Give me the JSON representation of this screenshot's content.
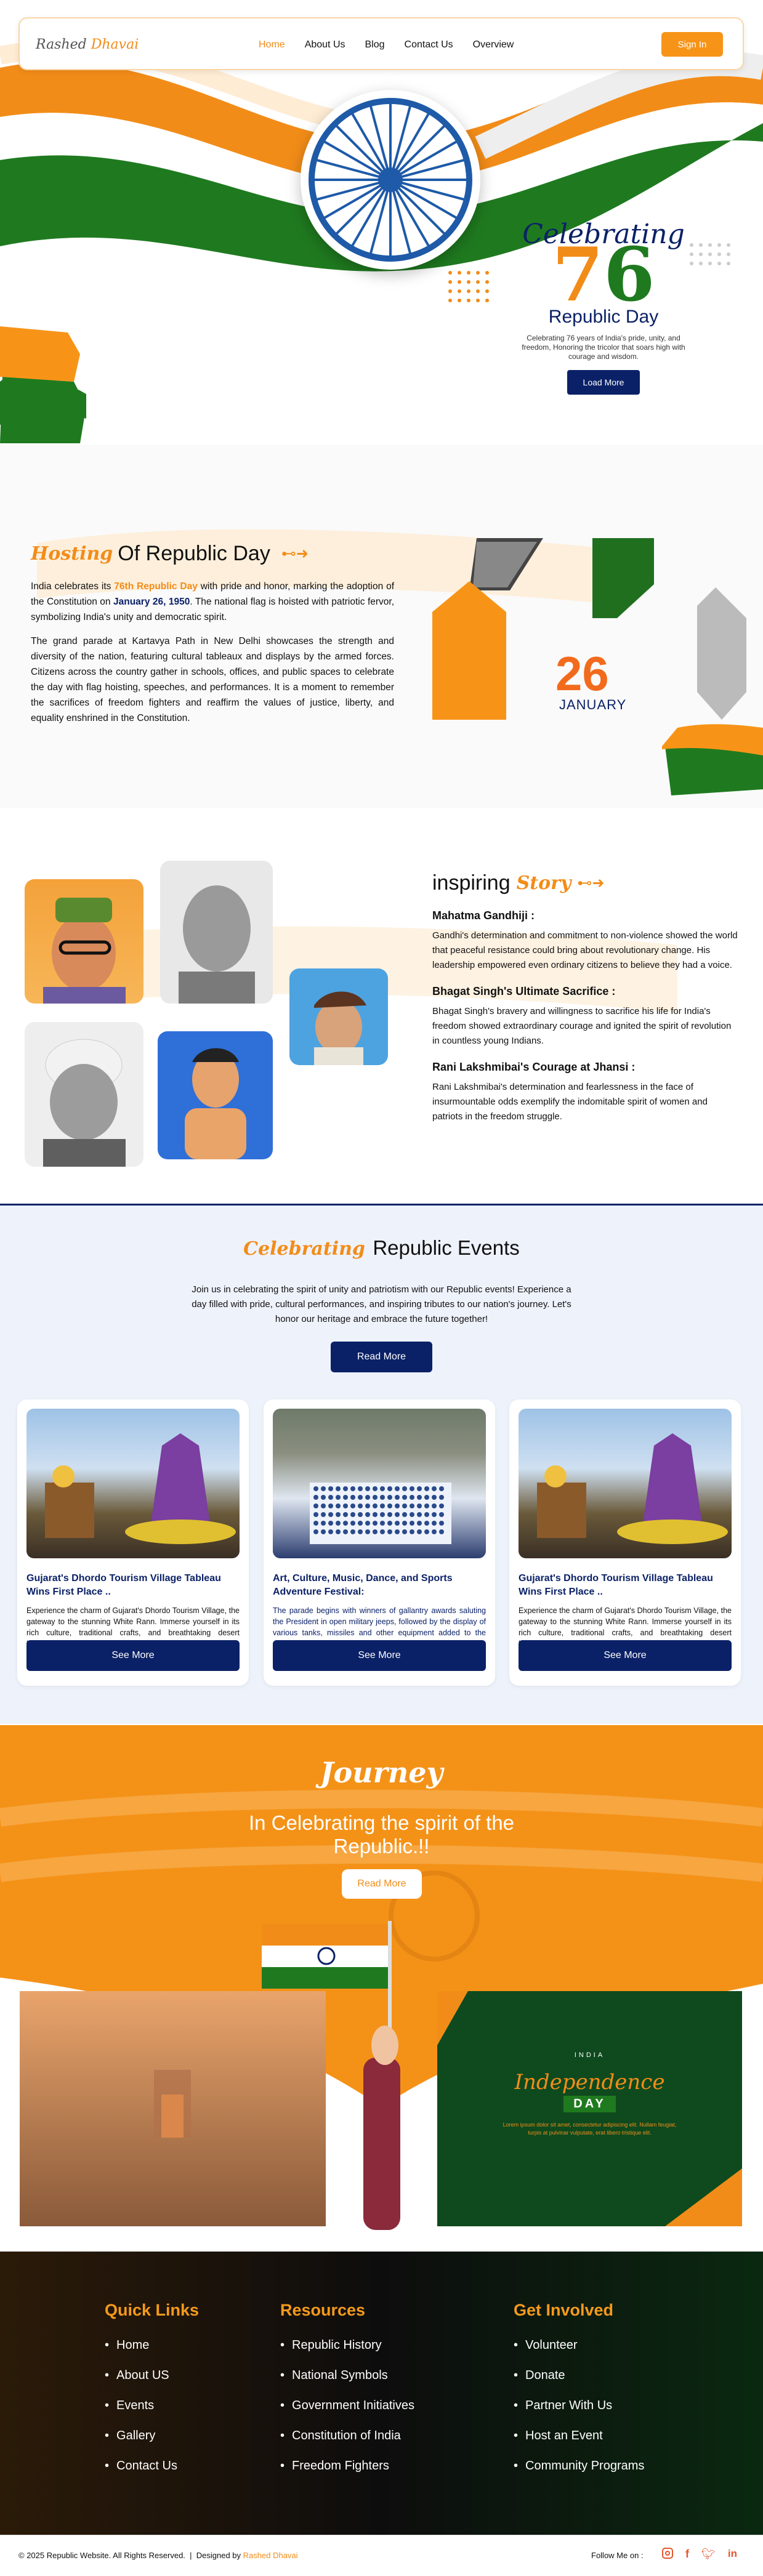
{
  "nav": {
    "logo_main": "Rashed",
    "logo_accent": "Dhavai",
    "links": [
      "Home",
      "About Us",
      "Blog",
      "Contact Us",
      "Overview"
    ],
    "signin": "Sign In"
  },
  "hero": {
    "celebrating": "Celebrating",
    "number": [
      "7",
      "6"
    ],
    "title": "Republic Day",
    "subtitle": "Celebrating 76 years of India's pride, unity, and freedom, Honoring the tricolor that soars high with courage and wisdom.",
    "button": "Load More"
  },
  "hosting": {
    "title_script": "Hosting",
    "title_rest": "Of Republic Day",
    "p1_a": "India celebrates its ",
    "p1_b": "76th Republic Day",
    "p1_c": " with pride and honor, marking the adoption of the Constitution on ",
    "p1_d": "January 26, 1950",
    "p1_e": ". The national flag is hoisted with patriotic fervor, symbolizing India's unity and democratic spirit.",
    "p2": "The grand parade at Kartavya Path in New Delhi showcases the strength and diversity of the nation, featuring cultural tableaux and displays by the armed forces. Citizens across the country gather in schools, offices, and public spaces to celebrate the day with flag hoisting, speeches, and performances. It is a moment to remember the sacrifices of freedom fighters and reaffirm the values of justice, liberty, and equality enshrined in the Constitution.",
    "date_num": "26",
    "date_month": "JANUARY"
  },
  "inspiring": {
    "title_a": "inspiring",
    "title_b": "Story",
    "people": [
      {
        "name": "Mahatma Gandhiji :",
        "text": "Gandhi's determination and commitment to non-violence showed the world that peaceful resistance could bring about revolutionary change. His leadership empowered even ordinary citizens to believe they had a voice."
      },
      {
        "name": "Bhagat Singh's Ultimate Sacrifice :",
        "text": "Bhagat Singh's bravery and willingness to sacrifice his life for India's freedom showed extraordinary courage and ignited the spirit of revolution in countless young Indians."
      },
      {
        "name": "Rani Lakshmibai's Courage at Jhansi :",
        "text": "Rani Lakshmibai's determination and fearlessness in the face of insurmountable odds exemplify the indomitable spirit of women and patriots in the freedom struggle."
      }
    ]
  },
  "events": {
    "title_a": "Celebrating",
    "title_b": "Republic Events",
    "intro": "Join us in celebrating the spirit of unity and patriotism with our Republic events! Experience a day filled with pride, cultural performances, and inspiring tributes to our nation's journey. Let's honor our heritage and embrace the future together!",
    "button": "Read More",
    "cards": [
      {
        "title": "Gujarat's Dhordo Tourism Village Tableau Wins First Place ..",
        "desc": "Experience the charm of Gujarat's Dhordo Tourism Village, the gateway to the stunning White Rann. Immerse yourself in its rich culture, traditional crafts, and breathtaking desert landscapes!",
        "button": "See More"
      },
      {
        "title": "Art, Culture, Music, Dance, and Sports Adventure Festival:",
        "desc": "The parade begins with winners of gallantry awards saluting the President in open military jeeps, followed by the display of various tanks, missiles and other equipment added to the arsenal of the military.",
        "button": "See More"
      },
      {
        "title": "Gujarat's Dhordo Tourism Village Tableau Wins First Place ..",
        "desc": "Experience the charm of Gujarat's Dhordo Tourism Village, the gateway to the stunning White Rann. Immerse yourself in its rich culture, traditional crafts, and breathtaking desert landscapes!",
        "button": "See More"
      }
    ]
  },
  "journey": {
    "script": "Journey",
    "headline": "In Celebrating the spirit of the Republic.!!",
    "button": "Read More",
    "poster_india": "INDIA",
    "poster_title": "Independence",
    "poster_day": "DAY",
    "poster_text": "Lorem ipsum dolor sit amet, consectetur adipiscing elit. Nullam feugiat, turpis at pulvinar vulputate, erat libero tristique elit."
  },
  "footer": {
    "cols": [
      {
        "title": "Quick Links",
        "items": [
          "Home",
          "About US",
          "Events",
          "Gallery",
          "Contact Us"
        ]
      },
      {
        "title": "Resources",
        "items": [
          "Republic History",
          "National Symbols",
          "Government Initiatives",
          "Constitution of India",
          "Freedom Fighters"
        ]
      },
      {
        "title": "Get Involved",
        "items": [
          "Volunteer",
          "Donate",
          "Partner With Us",
          "Host an Event",
          "Community Programs"
        ]
      }
    ],
    "copyright": "© 2025 Republic Website. All Rights Reserved.",
    "designed_label": "Designed by",
    "designer": "Rashed Dhavai",
    "follow": "Follow Me on :",
    "social_icons": [
      "instagram-icon",
      "facebook-icon",
      "twitter-icon",
      "linkedin-icon"
    ]
  },
  "colors": {
    "saffron": "#f28c18",
    "green": "#1f7a1f",
    "navy": "#0b2167"
  }
}
